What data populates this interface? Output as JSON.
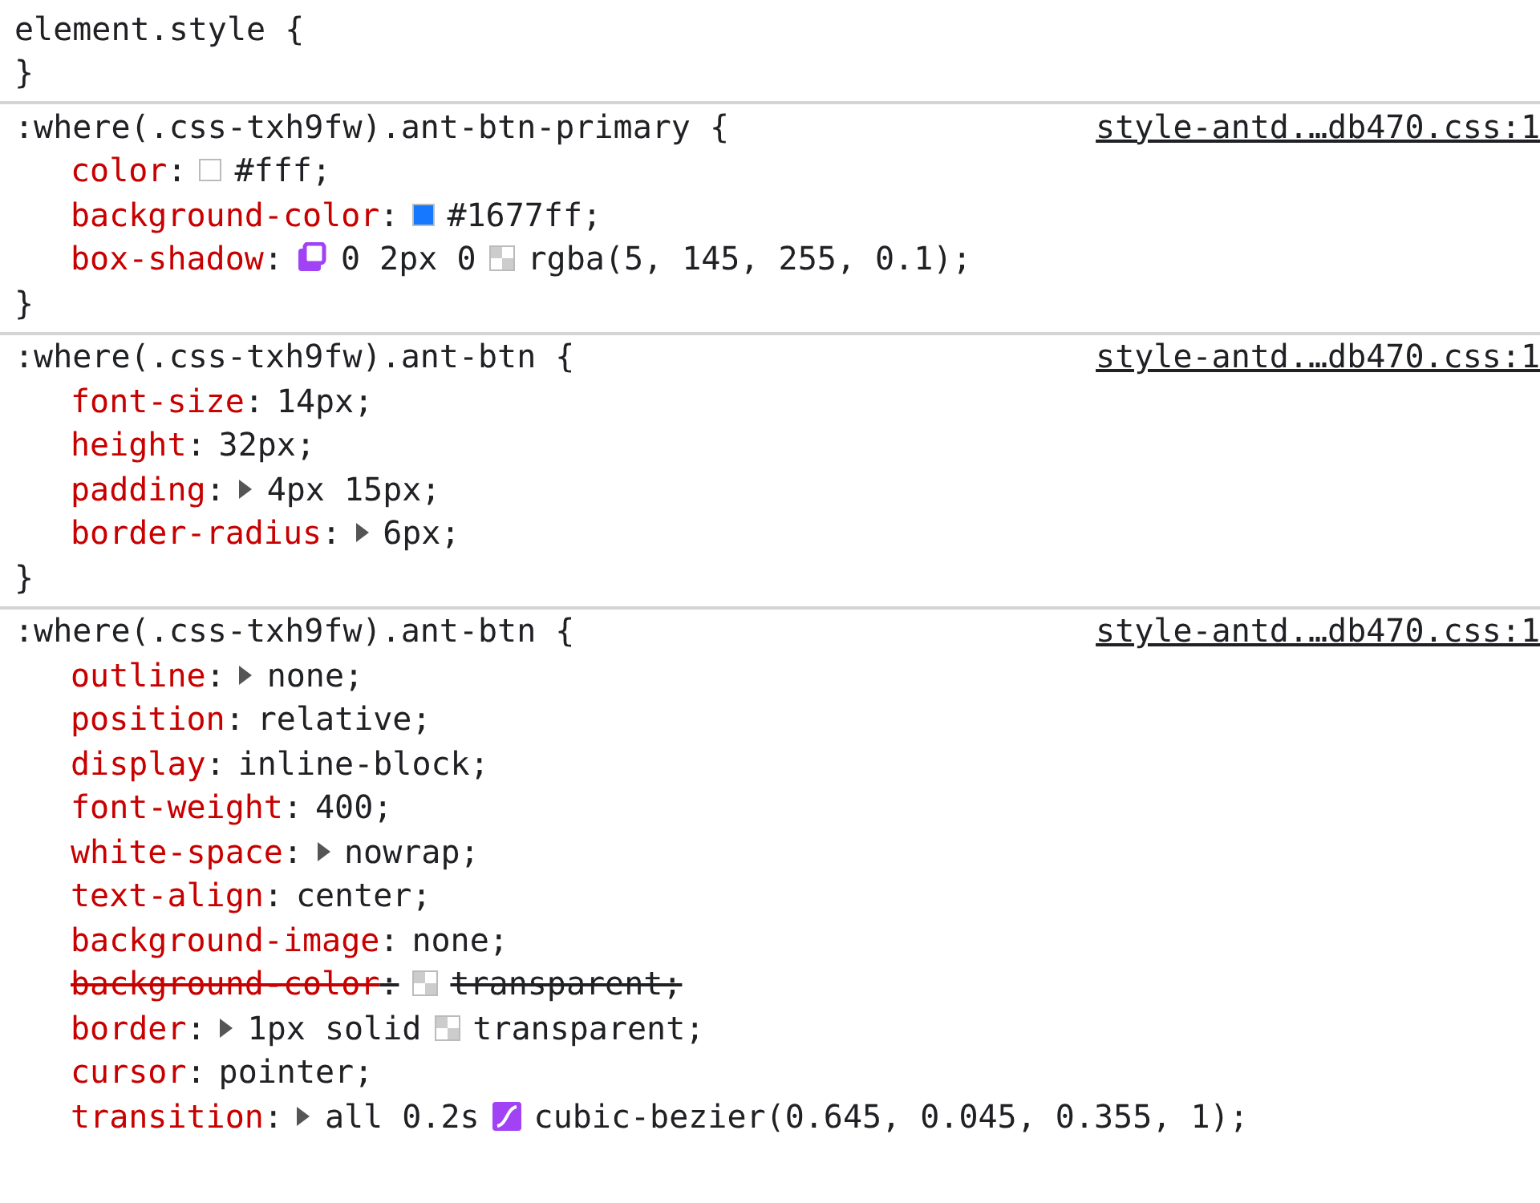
{
  "rules": [
    {
      "selector": "element.style {",
      "close": "}"
    },
    {
      "selector": ":where(.css-txh9fw).ant-btn-primary {",
      "source": "style-antd.…db470.css:1",
      "close": "}",
      "declarations": [
        {
          "property": "color",
          "separator": ":",
          "overridden": false,
          "value": [
            {
              "kind": "swatch",
              "color": "#ffffff"
            },
            {
              "kind": "text",
              "text": "#fff;"
            }
          ]
        },
        {
          "property": "background-color",
          "separator": ":",
          "overridden": false,
          "value": [
            {
              "kind": "swatch",
              "color": "#1677ff"
            },
            {
              "kind": "text",
              "text": "#1677ff;"
            }
          ]
        },
        {
          "property": "box-shadow",
          "separator": ":",
          "overridden": false,
          "value": [
            {
              "kind": "shadow-editor"
            },
            {
              "kind": "text",
              "text": "0 2px 0"
            },
            {
              "kind": "checker-swatch"
            },
            {
              "kind": "text",
              "text": "rgba(5, 145, 255, 0.1);"
            }
          ]
        }
      ]
    },
    {
      "selector": ":where(.css-txh9fw).ant-btn {",
      "source": "style-antd.…db470.css:1",
      "close": "}",
      "declarations": [
        {
          "property": "font-size",
          "separator": ":",
          "overridden": false,
          "value": [
            {
              "kind": "text",
              "text": "14px;"
            }
          ]
        },
        {
          "property": "height",
          "separator": ":",
          "overridden": false,
          "value": [
            {
              "kind": "text",
              "text": "32px;"
            }
          ]
        },
        {
          "property": "padding",
          "separator": ":",
          "overridden": false,
          "value": [
            {
              "kind": "expander"
            },
            {
              "kind": "text",
              "text": "4px 15px;"
            }
          ]
        },
        {
          "property": "border-radius",
          "separator": ":",
          "overridden": false,
          "value": [
            {
              "kind": "expander"
            },
            {
              "kind": "text",
              "text": "6px;"
            }
          ]
        }
      ]
    },
    {
      "selector": ":where(.css-txh9fw).ant-btn {",
      "source": "style-antd.…db470.css:1",
      "declarations": [
        {
          "property": "outline",
          "separator": ":",
          "overridden": false,
          "value": [
            {
              "kind": "expander"
            },
            {
              "kind": "text",
              "text": "none;"
            }
          ]
        },
        {
          "property": "position",
          "separator": ":",
          "overridden": false,
          "value": [
            {
              "kind": "text",
              "text": "relative;"
            }
          ]
        },
        {
          "property": "display",
          "separator": ":",
          "overridden": false,
          "value": [
            {
              "kind": "text",
              "text": "inline-block;"
            }
          ]
        },
        {
          "property": "font-weight",
          "separator": ":",
          "overridden": false,
          "value": [
            {
              "kind": "text",
              "text": "400;"
            }
          ]
        },
        {
          "property": "white-space",
          "separator": ":",
          "overridden": false,
          "value": [
            {
              "kind": "expander"
            },
            {
              "kind": "text",
              "text": "nowrap;"
            }
          ]
        },
        {
          "property": "text-align",
          "separator": ":",
          "overridden": false,
          "value": [
            {
              "kind": "text",
              "text": "center;"
            }
          ]
        },
        {
          "property": "background-image",
          "separator": ":",
          "overridden": false,
          "value": [
            {
              "kind": "text",
              "text": "none;"
            }
          ]
        },
        {
          "property": "background-color",
          "separator": ":",
          "overridden": true,
          "value": [
            {
              "kind": "checker-swatch"
            },
            {
              "kind": "text",
              "text": "transparent;"
            }
          ]
        },
        {
          "property": "border",
          "separator": ":",
          "overridden": false,
          "value": [
            {
              "kind": "expander"
            },
            {
              "kind": "text",
              "text": "1px solid"
            },
            {
              "kind": "checker-swatch"
            },
            {
              "kind": "text",
              "text": "transparent;"
            }
          ]
        },
        {
          "property": "cursor",
          "separator": ":",
          "overridden": false,
          "value": [
            {
              "kind": "text",
              "text": "pointer;"
            }
          ]
        },
        {
          "property": "transition",
          "separator": ":",
          "overridden": false,
          "value": [
            {
              "kind": "expander"
            },
            {
              "kind": "text",
              "text": "all 0.2s"
            },
            {
              "kind": "easing-editor"
            },
            {
              "kind": "text",
              "text": "cubic-bezier(0.645, 0.045, 0.355, 1);"
            }
          ]
        }
      ]
    }
  ]
}
